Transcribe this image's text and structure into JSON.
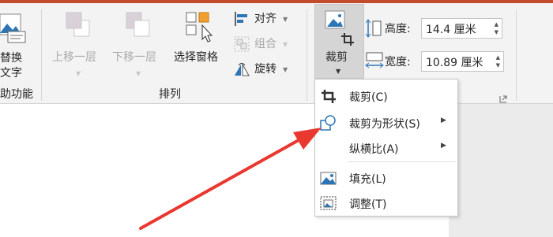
{
  "ribbon": {
    "accessibility_group": {
      "replace_text_label_line1": "替换",
      "replace_text_label_line2": "文字",
      "group_label": "助功能"
    },
    "arrange_group": {
      "bring_forward_label": "上移一层",
      "send_backward_label": "下移一层",
      "selection_pane_label": "选择窗格",
      "align_label": "对齐",
      "group_objects_label": "组合",
      "rotate_label": "旋转",
      "group_label": "排列"
    },
    "size_group": {
      "crop_label": "裁剪",
      "height_label": "高度:",
      "height_value": "14.4 厘米",
      "width_label": "宽度:",
      "width_value": "10.89 厘米"
    }
  },
  "crop_menu": {
    "items": [
      {
        "label": "裁剪(C)",
        "icon": "crop-icon",
        "submenu": false
      },
      {
        "label": "裁剪为形状(S)",
        "icon": "shapes-icon",
        "submenu": true
      },
      {
        "label": "纵横比(A)",
        "icon": "",
        "submenu": true
      },
      {
        "label": "填充(L)",
        "icon": "fill-picture-icon",
        "submenu": false
      },
      {
        "label": "调整(T)",
        "icon": "fit-picture-icon",
        "submenu": false
      }
    ]
  },
  "colors": {
    "title_bar": "#c24a2d",
    "ribbon_bg": "#f3f3f3",
    "workspace_bg": "#ebebeb",
    "annotation_arrow": "#e8382f",
    "icon_blue": "#2e75b6",
    "icon_orange": "#f0a030"
  }
}
